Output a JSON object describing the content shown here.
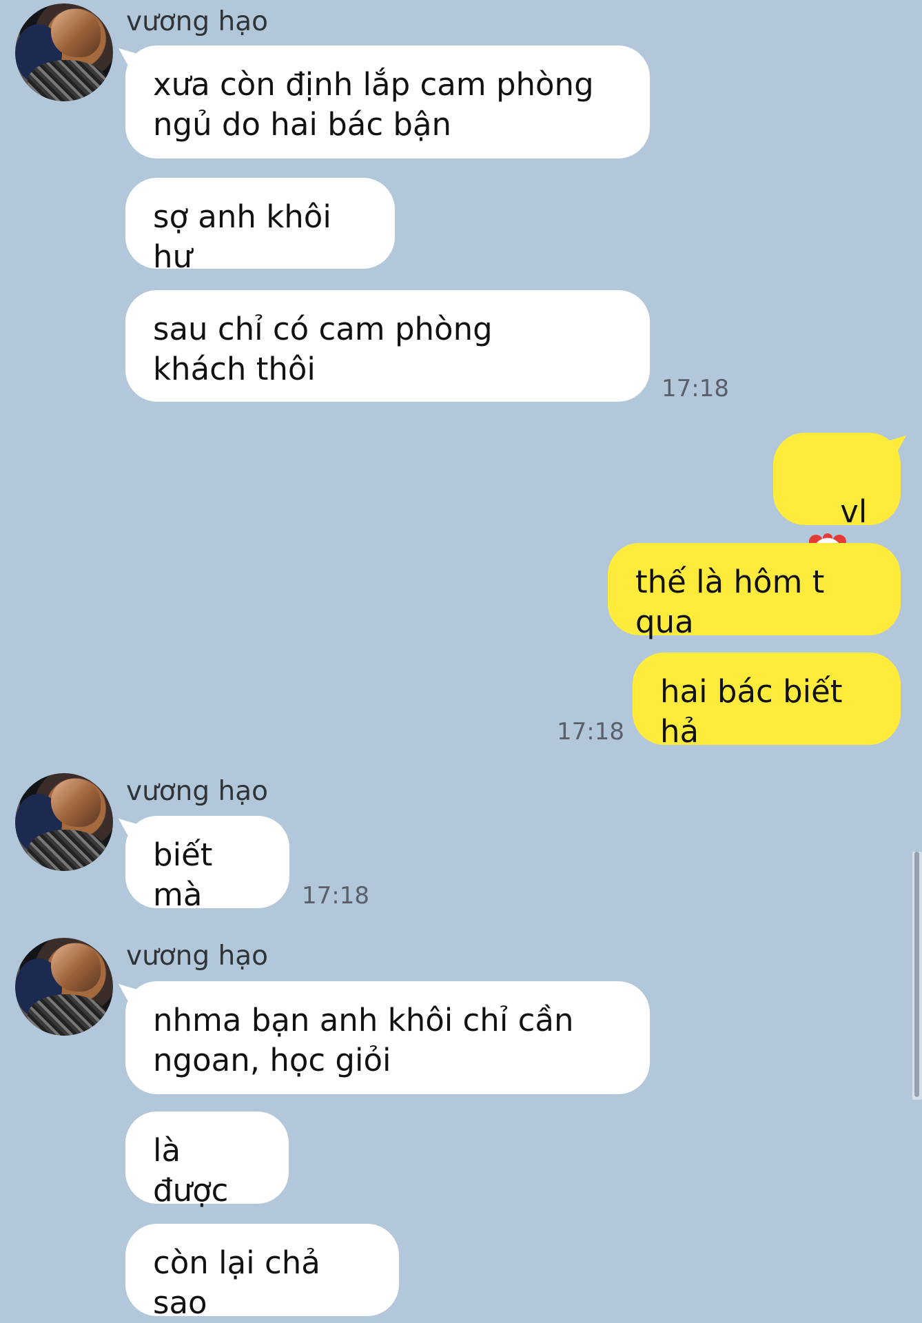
{
  "sender": {
    "name": "vương hạo",
    "avatar_icon": "profile-photo"
  },
  "messages": [
    {
      "side": "in",
      "text": "xưa còn định lắp cam phòng ngủ do hai bác bận"
    },
    {
      "side": "in",
      "text": "sợ anh khôi hư"
    },
    {
      "side": "in",
      "text": "sau chỉ có cam phòng khách thôi",
      "time": "17:18"
    },
    {
      "side": "out",
      "text": "vl",
      "emoji": "clown-face"
    },
    {
      "side": "out",
      "text": "thế là hôm t qua"
    },
    {
      "side": "out",
      "text": "hai bác biết hả",
      "time": "17:18"
    },
    {
      "side": "in",
      "text": "biết mà",
      "time": "17:18"
    },
    {
      "side": "in",
      "text": "nhma bạn anh khôi chỉ cần ngoan, học giỏi"
    },
    {
      "side": "in",
      "text": "là được"
    },
    {
      "side": "in",
      "text": "còn lại chả sao"
    }
  ],
  "colors": {
    "background": "#b2c7da",
    "incoming_bubble": "#ffffff",
    "outgoing_bubble": "#ffeb3b"
  }
}
